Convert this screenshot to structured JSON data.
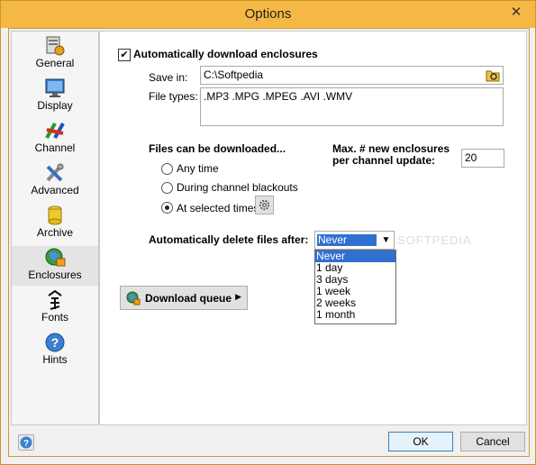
{
  "window": {
    "title": "Options",
    "close_glyph": "✕"
  },
  "sidebar": {
    "items": [
      {
        "label": "General",
        "icon": "general-icon"
      },
      {
        "label": "Display",
        "icon": "display-icon"
      },
      {
        "label": "Channel",
        "icon": "channel-icon"
      },
      {
        "label": "Advanced",
        "icon": "advanced-icon"
      },
      {
        "label": "Archive",
        "icon": "archive-icon"
      },
      {
        "label": "Enclosures",
        "icon": "enclosures-icon",
        "selected": true
      },
      {
        "label": "Fonts",
        "icon": "fonts-icon"
      },
      {
        "label": "Hints",
        "icon": "hints-icon"
      }
    ]
  },
  "enclosures": {
    "auto_download_label": "Automatically download enclosures",
    "auto_download_checked": true,
    "save_in_label": "Save in:",
    "save_in_value": "C:\\Softpedia",
    "file_types_label": "File types:",
    "file_types_value": ".MP3 .MPG .MPEG .AVI .WMV",
    "files_downloaded_label": "Files can be downloaded...",
    "max_label_line1": "Max. #  new enclosures",
    "max_label_line2": "per channel update:",
    "max_value": "20",
    "radio_any_time": "Any time",
    "radio_blackouts": "During channel blackouts",
    "radio_selected": "At selected times",
    "selected_radio": "At selected times",
    "auto_delete_label": "Automatically delete files after:",
    "auto_delete_value": "Never",
    "auto_delete_options": [
      "Never",
      "1 day",
      "3 days",
      "1 week",
      "2 weeks",
      "1 month"
    ],
    "download_queue_label": "Download queue",
    "watermark": "SOFTPEDIA"
  },
  "footer": {
    "help_glyph": "?",
    "ok_label": "OK",
    "cancel_label": "Cancel"
  },
  "colors": {
    "title_bar": "#f5b845",
    "highlight": "#3070d0"
  }
}
